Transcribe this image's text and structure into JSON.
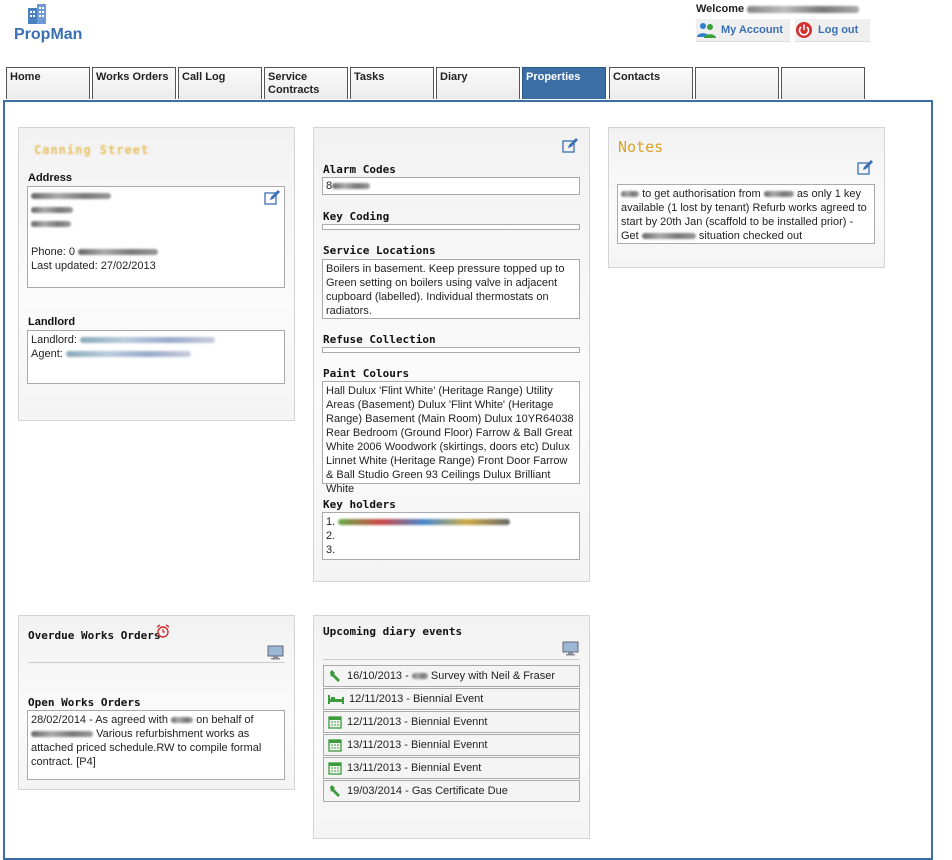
{
  "app": {
    "name": "PropMan"
  },
  "header": {
    "welcome": "Welcome",
    "my_account": "My Account",
    "log_out": "Log out"
  },
  "tabs": [
    {
      "label": "Home"
    },
    {
      "label": "Works Orders"
    },
    {
      "label": "Call Log"
    },
    {
      "label": "Service Contracts"
    },
    {
      "label": "Tasks"
    },
    {
      "label": "Diary"
    },
    {
      "label": "Properties",
      "active": true
    },
    {
      "label": "Contacts"
    },
    {
      "label": ""
    },
    {
      "label": ""
    }
  ],
  "property": {
    "street_blurred": "Canning Street",
    "address_label": "Address",
    "phone_label": "Phone: 0",
    "last_updated": "Last updated: 27/02/2013",
    "landlord_label": "Landlord",
    "landlord_field": "Landlord:",
    "agent_field": "Agent:"
  },
  "details": {
    "alarm_label": "Alarm Codes",
    "alarm_value": "8",
    "key_coding_label": "Key Coding",
    "service_locations_label": "Service Locations",
    "service_locations_value": "Boilers in basement. Keep pressure topped up to Green setting on boilers using valve in adjacent cupboard (labelled). Individual thermostats on radiators.",
    "refuse_label": "Refuse Collection",
    "paint_label": "Paint Colours",
    "paint_value": "Hall Dulux 'Flint White' (Heritage Range) Utility Areas (Basement) Dulux 'Flint White' (Heritage Range) Basement (Main Room) Dulux 10YR64038 Rear Bedroom (Ground Floor) Farrow & Ball Great White 2006 Woodwork (skirtings, doors etc) Dulux Linnet White (Heritage Range) Front Door Farrow & Ball Studio Green 93 Ceilings Dulux Brilliant White",
    "key_holders_label": "Key holders",
    "key_holders": [
      "1.",
      "2.",
      "3."
    ]
  },
  "notes": {
    "title": "Notes",
    "text_a": "to get authorisation from",
    "text_b": "as only 1 key available (1 lost by tenant) Refurb works agreed to start by 20th Jan (scaffold to be installed prior) - Get",
    "text_c": "situation checked out"
  },
  "overdue": {
    "title": "Overdue Works Orders",
    "open_title": "Open Works Orders",
    "order_a": "28/02/2014 - As agreed with",
    "order_b": "on behalf of",
    "order_c": "Various refurbishment works as attached priced schedule.RW to compile formal contract. [P4]"
  },
  "diary": {
    "title": "Upcoming diary events",
    "events": [
      {
        "icon": "wrench-icon",
        "date": "16/10/2013 -",
        "text": "Survey with Neil & Fraser"
      },
      {
        "icon": "bed-icon",
        "date": "12/11/2013 -",
        "text": "Biennial Event"
      },
      {
        "icon": "calendar-icon",
        "date": "12/11/2013 -",
        "text": "Biennial Evennt"
      },
      {
        "icon": "calendar-icon",
        "date": "13/11/2013 -",
        "text": "Biennial Evennt"
      },
      {
        "icon": "calendar-icon",
        "date": "13/11/2013 -",
        "text": "Biennial Event"
      },
      {
        "icon": "wrench-icon",
        "date": "19/03/2014 -",
        "text": "Gas Certificate Due"
      }
    ]
  },
  "colors": {
    "accent": "#3a6ea5",
    "notes_title": "#d9a22b",
    "link": "#3a6fb3"
  }
}
